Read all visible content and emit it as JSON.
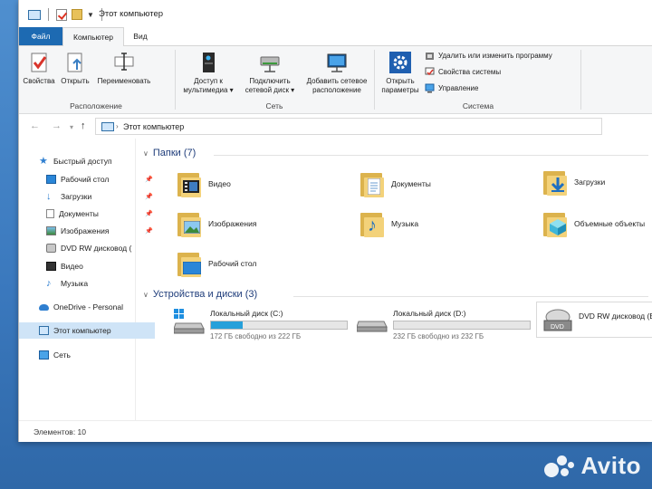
{
  "window": {
    "title": "Этот компьютер"
  },
  "tabs": [
    {
      "label": "Файл"
    },
    {
      "label": "Компьютер"
    },
    {
      "label": "Вид"
    }
  ],
  "ribbon": {
    "groups": [
      {
        "label": "Расположение",
        "buttons": [
          "Свойства",
          "Открыть",
          "Переименовать"
        ]
      },
      {
        "label": "Сеть",
        "buttons": [
          "Доступ к мультимедиа",
          "Подключить сетевой диск",
          "Добавить сетевое расположение"
        ]
      },
      {
        "label": "Система",
        "buttons": [
          "Открыть параметры"
        ],
        "small": [
          "Удалить или изменить программу",
          "Свойства системы",
          "Управление"
        ]
      }
    ],
    "b": {
      "props": "Свойства",
      "open": "Открыть",
      "rename": "Переименовать",
      "media_1": "Доступ к",
      "media_2": "мультимедиа",
      "map_1": "Подключить",
      "map_2": "сетевой диск",
      "addnet_1": "Добавить сетевое",
      "addnet_2": "расположение",
      "settings_1": "Открыть",
      "settings_2": "параметры",
      "uninstall": "Удалить или изменить программу",
      "sysprops": "Свойства системы",
      "manage": "Управление",
      "g_location": "Расположение",
      "g_network": "Сеть",
      "g_system": "Система"
    }
  },
  "address": {
    "path": "Этот компьютер"
  },
  "nav": {
    "quick_access": "Быстрый доступ",
    "desktop": "Рабочий стол",
    "downloads": "Загрузки",
    "documents": "Документы",
    "pictures": "Изображения",
    "dvd": "DVD RW дисковод (",
    "video": "Видео",
    "music": "Музыка",
    "onedrive": "OneDrive - Personal",
    "this_pc": "Этот компьютер",
    "network": "Сеть"
  },
  "folders_section": {
    "title": "Папки (7)"
  },
  "folders": [
    {
      "name": "Видео"
    },
    {
      "name": "Документы"
    },
    {
      "name": "Загрузки"
    },
    {
      "name": "Изображения"
    },
    {
      "name": "Музыка"
    },
    {
      "name": "Объемные объекты"
    },
    {
      "name": "Рабочий стол"
    }
  ],
  "drives_section": {
    "title": "Устройства и диски (3)"
  },
  "drives": [
    {
      "name": "Локальный диск (C:)",
      "free": "172 ГБ свободно из 222 ГБ",
      "used_fraction": 0.23
    },
    {
      "name": "Локальный диск (D:)",
      "free": "232 ГБ свободно из 232 ГБ",
      "used_fraction": 0.0
    },
    {
      "name": "DVD RW дисковод (E:)",
      "badge": "DVD"
    }
  ],
  "status": {
    "items": "Элементов: 10"
  },
  "watermark": {
    "text": "Avito"
  },
  "colors": {
    "accent": "#1d6ab2",
    "selection": "#cfe4f7",
    "drive_bar": "#26a0da"
  }
}
